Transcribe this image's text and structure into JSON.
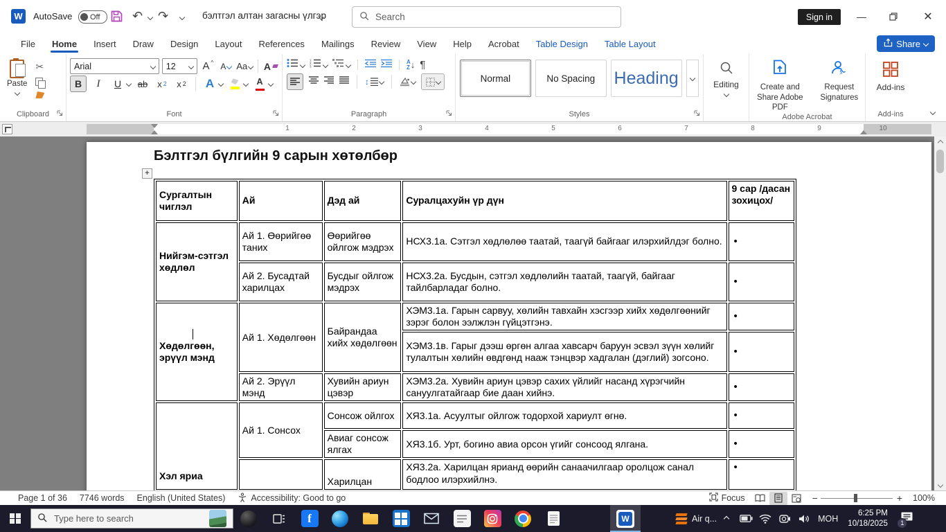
{
  "title_bar": {
    "autosave_label": "AutoSave",
    "autosave_state": "Off",
    "document_title": "бэлтгэл алтан загасны үлгэр",
    "search_placeholder": "Search",
    "sign_in_label": "Sign in"
  },
  "ribbon_tabs": {
    "items": [
      {
        "label": "File"
      },
      {
        "label": "Home"
      },
      {
        "label": "Insert"
      },
      {
        "label": "Draw"
      },
      {
        "label": "Design"
      },
      {
        "label": "Layout"
      },
      {
        "label": "References"
      },
      {
        "label": "Mailings"
      },
      {
        "label": "Review"
      },
      {
        "label": "View"
      },
      {
        "label": "Help"
      },
      {
        "label": "Acrobat"
      },
      {
        "label": "Table Design"
      },
      {
        "label": "Table Layout"
      }
    ],
    "share_label": "Share"
  },
  "ribbon": {
    "paste_label": "Paste",
    "font_name": "Arial",
    "font_size": "12",
    "styles": {
      "normal": "Normal",
      "no_spacing": "No Spacing",
      "heading": "Heading"
    },
    "editing_label": "Editing",
    "create_pdf_label": "Create and Share Adobe PDF",
    "request_signatures_label": "Request Signatures",
    "addins_button_label": "Add-ins",
    "groups": {
      "clipboard": "Clipboard",
      "font": "Font",
      "paragraph": "Paragraph",
      "styles": "Styles",
      "adobe": "Adobe Acrobat",
      "addins": "Add-ins"
    }
  },
  "ruler": {
    "numbers": [
      "1",
      "2",
      "3",
      "4",
      "5",
      "6",
      "7",
      "8",
      "9",
      "10"
    ]
  },
  "document": {
    "title": "Бэлтгэл бүлгийн 9 сарын хөтөлбөр",
    "table": {
      "bullet": "•",
      "headers": [
        "Сургалтын чиглэл",
        "Ай",
        "Дэд ай",
        "Суралцахуйн үр дүн",
        "9 сар /дасан зохицох/"
      ],
      "rows": [
        {
          "section": "Нийгэм-сэтгэл хөдлөл",
          "ai": "Ай 1. Өөрийгөө таних",
          "ded_ai": "Өөрийгөө ойлгож мэдрэх",
          "result": "НСХ3.1а. Сэтгэл хөдлөлөө таатай, таагүй байгааг илэрхийлдэг болно."
        },
        {
          "ai": "Ай 2. Бусадтай харилцах",
          "ded_ai": "Бусдыг ойлгож мэдрэх",
          "result": "НСХ3.2а. Бусдын, сэтгэл хөдлөлийн таатай, таагүй, байгааг тайлбарладаг болно."
        },
        {
          "section": "Хөдөлгөөн, эрүүл мэнд",
          "ai": "Ай 1. Хөдөлгөөн",
          "ded_ai": "Байрандаа хийх хөдөлгөөн",
          "result": "ХЭМ3.1а. Гарын сарвуу, хөлийн тавхайн хэсгээр хийх хөдөлгөөнийг зэрэг болон ээлжлэн гүйцэтгэнэ."
        },
        {
          "result": "ХЭМ3.1в. Гарыг дээш өргөн алгаа хавсарч баруун эсвэл зүүн хөлийг тулалтын хөлийн өвдгөнд нааж тэнцвэр хадгалан (дэглий) зогсоно."
        },
        {
          "ai": "Ай 2. Эрүүл мэнд",
          "ded_ai": "Хувийн ариун цэвэр",
          "result": "ХЭМ3.2а. Хувийн ариун цэвэр сахих үйлийг насанд хүрэгчийн сануулгатайгаар бие даан хийнэ."
        },
        {
          "section": "Хэл яриа",
          "ai": "Ай 1. Сонсох",
          "ded_ai": "Сонсож ойлгох",
          "result": "ХЯ3.1а. Асуултыг ойлгож тодорхой хариулт өгнө."
        },
        {
          "ded_ai": "Авиаг сонсож ялгах",
          "result": "ХЯ3.1б. Урт, богино авиа орсон үгийг сонсоод ялгана."
        },
        {
          "ded_ai": "Харилцан",
          "result": "ХЯ3.2а. Харилцан ярианд өөрийн санаачилгаар оролцож санал бодлоо илэрхийлнэ."
        }
      ]
    }
  },
  "status_bar": {
    "page": "Page 1 of 36",
    "words": "7746 words",
    "language": "English (United States)",
    "accessibility": "Accessibility: Good to go",
    "focus_label": "Focus",
    "zoom_level": "100%"
  },
  "taskbar": {
    "search_placeholder": "Type here to search",
    "tray_app_label": "Air q...",
    "input_language": "MOH",
    "time": "6:25 PM",
    "date": "10/18/2025",
    "notification_count": "1"
  },
  "colors": {
    "word_blue": "#185abd",
    "share_blue": "#1e63c4",
    "taskbar_bg": "#1b1b2b"
  }
}
